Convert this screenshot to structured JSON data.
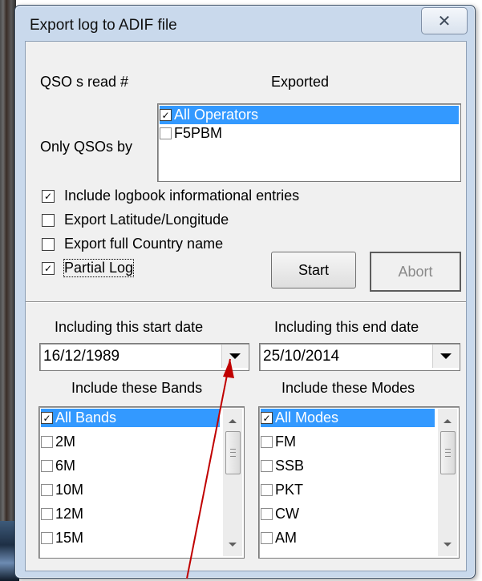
{
  "window": {
    "title": "Export log to ADIF file",
    "close_glyph": "✕"
  },
  "header": {
    "qso_read_label": "QSO s read #",
    "exported_label": "Exported",
    "only_qsos_by_label": "Only QSOs by"
  },
  "operators": [
    {
      "label": "All Operators",
      "checked": true,
      "selected": true
    },
    {
      "label": "F5PBM",
      "checked": false,
      "selected": false
    }
  ],
  "options": [
    {
      "label": "Include logbook informational entries",
      "checked": true
    },
    {
      "label": "Export Latitude/Longitude",
      "checked": false
    },
    {
      "label": "Export full Country name",
      "checked": false
    },
    {
      "label": "Partial Log",
      "checked": true
    }
  ],
  "buttons": {
    "start": "Start",
    "abort": "Abort"
  },
  "dates": {
    "start_label": "Including this start date",
    "start_value": "16/12/1989",
    "end_label": "Including this end date",
    "end_value": "25/10/2014"
  },
  "bands": {
    "label": "Include these Bands",
    "items": [
      {
        "label": "All Bands",
        "checked": true,
        "selected": true
      },
      {
        "label": "2M",
        "checked": false,
        "selected": false
      },
      {
        "label": "6M",
        "checked": false,
        "selected": false
      },
      {
        "label": "10M",
        "checked": false,
        "selected": false
      },
      {
        "label": "12M",
        "checked": false,
        "selected": false
      },
      {
        "label": "15M",
        "checked": false,
        "selected": false
      }
    ]
  },
  "modes": {
    "label": "Include these Modes",
    "items": [
      {
        "label": "All Modes",
        "checked": true,
        "selected": true
      },
      {
        "label": "FM",
        "checked": false,
        "selected": false
      },
      {
        "label": "SSB",
        "checked": false,
        "selected": false
      },
      {
        "label": "PKT",
        "checked": false,
        "selected": false
      },
      {
        "label": "CW",
        "checked": false,
        "selected": false
      },
      {
        "label": "AM",
        "checked": false,
        "selected": false
      }
    ]
  },
  "colors": {
    "selection": "#3399ff",
    "annotation_arrow": "#c00000"
  }
}
